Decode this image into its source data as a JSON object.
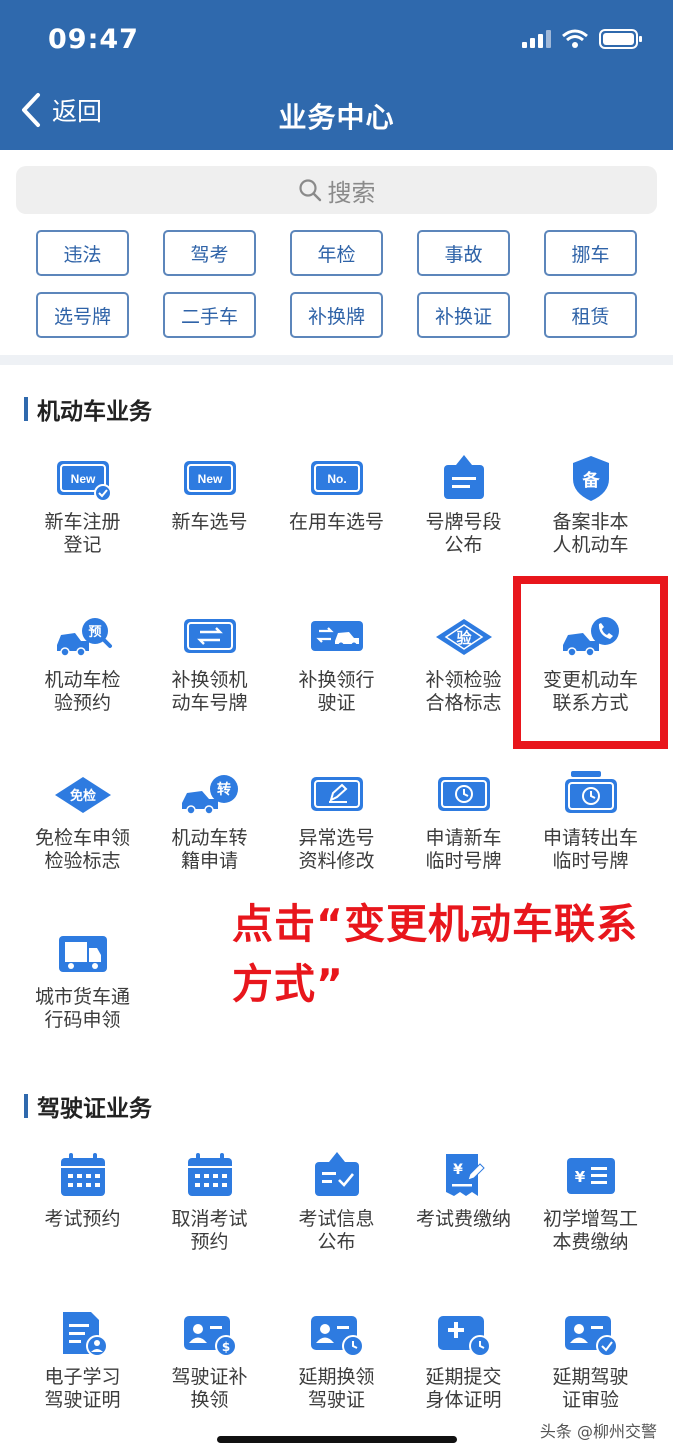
{
  "status_bar": {
    "time": "09:47"
  },
  "header": {
    "back_label": "返回",
    "title": "业务中心"
  },
  "search": {
    "placeholder": "搜索"
  },
  "quick_links": [
    "违法",
    "驾考",
    "年检",
    "事故",
    "挪车",
    "选号牌",
    "二手车",
    "补换牌",
    "补换证",
    "租赁"
  ],
  "sections": {
    "vehicle": {
      "title": "机动车业务",
      "items": [
        {
          "label": "新车注册\n登记",
          "icon": "new-plate-check-icon"
        },
        {
          "label": "新车选号",
          "icon": "new-plate-icon"
        },
        {
          "label": "在用车选号",
          "icon": "number-plate-icon"
        },
        {
          "label": "号牌号段\n公布",
          "icon": "announcement-board-icon"
        },
        {
          "label": "备案非本\n人机动车",
          "icon": "record-shield-icon"
        },
        {
          "label": "机动车检\n验预约",
          "icon": "car-inspection-reserve-icon"
        },
        {
          "label": "补换领机\n动车号牌",
          "icon": "plate-exchange-icon"
        },
        {
          "label": "补换领行\n驶证",
          "icon": "license-exchange-icon"
        },
        {
          "label": "补领检验\n合格标志",
          "icon": "inspection-mark-icon"
        },
        {
          "label": "变更机动车\n联系方式",
          "icon": "car-phone-icon"
        },
        {
          "label": "免检车申领\n检验标志",
          "icon": "exempt-inspection-icon"
        },
        {
          "label": "机动车转\n籍申请",
          "icon": "car-transfer-icon"
        },
        {
          "label": "异常选号\n资料修改",
          "icon": "plate-edit-icon"
        },
        {
          "label": "申请新车\n临时号牌",
          "icon": "temp-plate-icon"
        },
        {
          "label": "申请转出车\n临时号牌",
          "icon": "temp-plate-out-icon"
        },
        {
          "label": "城市货车通\n行码申领",
          "icon": "truck-icon"
        }
      ]
    },
    "license": {
      "title": "驾驶证业务",
      "items": [
        {
          "label": "考试预约",
          "icon": "calendar-icon"
        },
        {
          "label": "取消考试\n预约",
          "icon": "calendar-cancel-icon"
        },
        {
          "label": "考试信息\n公布",
          "icon": "exam-info-icon"
        },
        {
          "label": "考试费缴纳",
          "icon": "exam-fee-icon"
        },
        {
          "label": "初学增驾工\n本费缴纳",
          "icon": "fee-payment-icon"
        },
        {
          "label": "电子学习\n驾驶证明",
          "icon": "e-learning-cert-icon"
        },
        {
          "label": "驾驶证补\n换领",
          "icon": "license-renew-icon"
        },
        {
          "label": "延期换领\n驾驶证",
          "icon": "license-delay-icon"
        },
        {
          "label": "延期提交\n身体证明",
          "icon": "health-cert-delay-icon"
        },
        {
          "label": "延期驾驶\n证审验",
          "icon": "license-review-delay-icon"
        }
      ]
    }
  },
  "annotation": "点击“变更机动车联系方式”",
  "watermark": "头条 @柳州交警",
  "colors": {
    "header": "#2f69ad",
    "icon_blue": "#2e7be0",
    "chip_border": "#5c86bb",
    "annotation_red": "#e8161c"
  }
}
